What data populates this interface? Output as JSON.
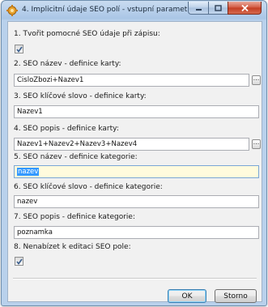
{
  "window": {
    "title": "4. Implicitní údaje SEO polí - vstupní parametry",
    "icon": "gear-icon"
  },
  "caption_buttons": {
    "minimize": "minimize-icon",
    "maximize": "maximize-icon",
    "close": "close-icon"
  },
  "fields": [
    {
      "label": "1. Tvořit pomocné SEO údaje při zápisu:",
      "type": "checkbox",
      "checked": true
    },
    {
      "label": "2. SEO název - definice karty:",
      "type": "text",
      "value": "CisloZbozi+Nazev1",
      "browse": true
    },
    {
      "label": "3. SEO klíčové slovo - definice karty:",
      "type": "text",
      "value": "Nazev1",
      "browse": false
    },
    {
      "label": "4. SEO popis - definice karty:",
      "type": "text",
      "value": "Nazev1+Nazev2+Nazev3+Nazev4",
      "browse": true
    },
    {
      "label": "5. SEO název - definice kategorie:",
      "type": "text",
      "value": "nazev",
      "browse": false,
      "focused": true,
      "selected": true
    },
    {
      "label": "6. SEO klíčové slovo - definice kategorie:",
      "type": "text",
      "value": "nazev",
      "browse": false
    },
    {
      "label": "7. SEO popis - definice kategorie:",
      "type": "text",
      "value": "poznamka",
      "browse": false
    },
    {
      "label": "8. Nenabízet k editaci SEO pole:",
      "type": "checkbox",
      "checked": true
    }
  ],
  "browse_button_label": "...",
  "buttons": {
    "ok": "OK",
    "cancel": "Storno"
  },
  "colors": {
    "title_bar": "#aac6e6",
    "close_button": "#c33d22",
    "focused_field_bg": "#fffbdd",
    "selection": "#3399ff"
  }
}
